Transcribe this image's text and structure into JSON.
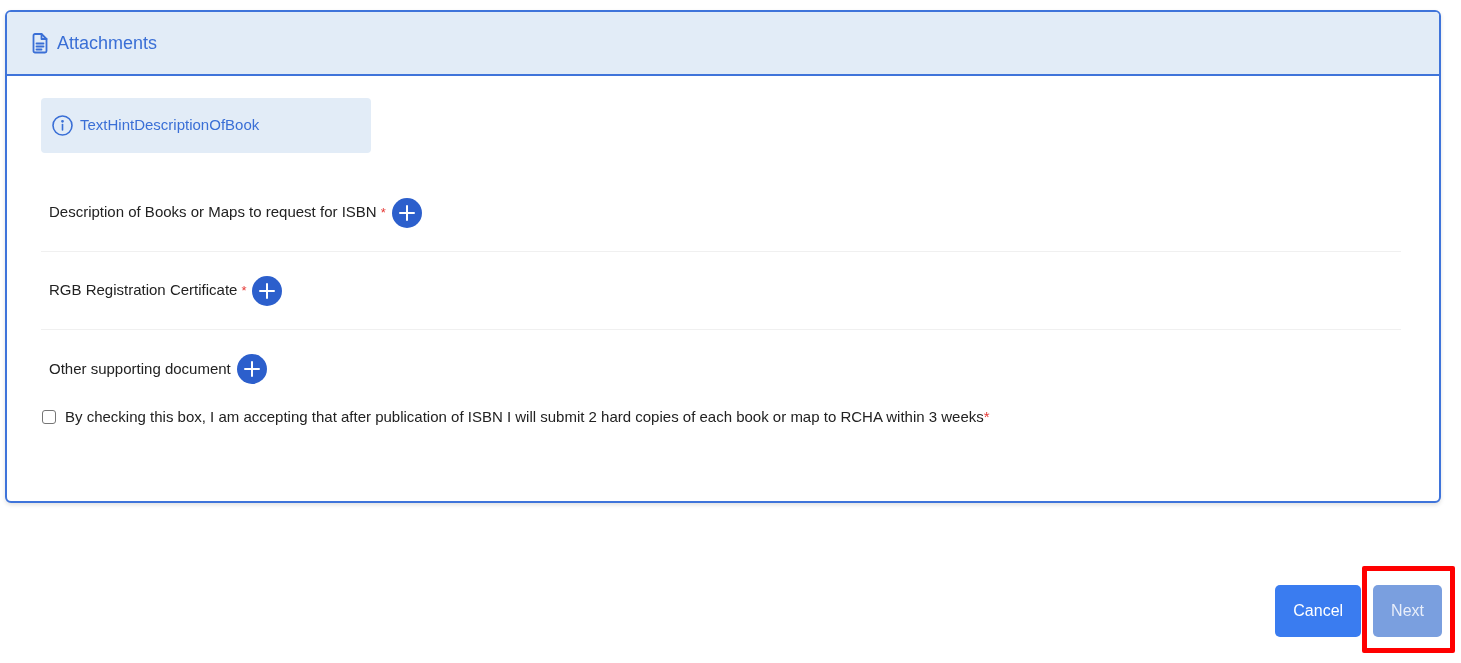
{
  "panel": {
    "title": "Attachments",
    "hint": "TextHintDescriptionOfBook",
    "attachments": [
      {
        "label": "Description of Books or Maps to request for ISBN",
        "required_mark": "*"
      },
      {
        "label": "RGB Registration Certificate",
        "required_mark": "*"
      },
      {
        "label": "Other supporting document"
      }
    ],
    "agreement": {
      "label": "By checking this box, I am accepting that after publication of ISBN I will submit 2 hard copies of each book or map to RCHA within 3 weeks",
      "required_mark": "*",
      "checked": false
    }
  },
  "buttons": [
    {
      "label": "Cancel",
      "disabled": false,
      "highlighted": false
    },
    {
      "label": "Next",
      "disabled": true,
      "highlighted": true
    }
  ]
}
